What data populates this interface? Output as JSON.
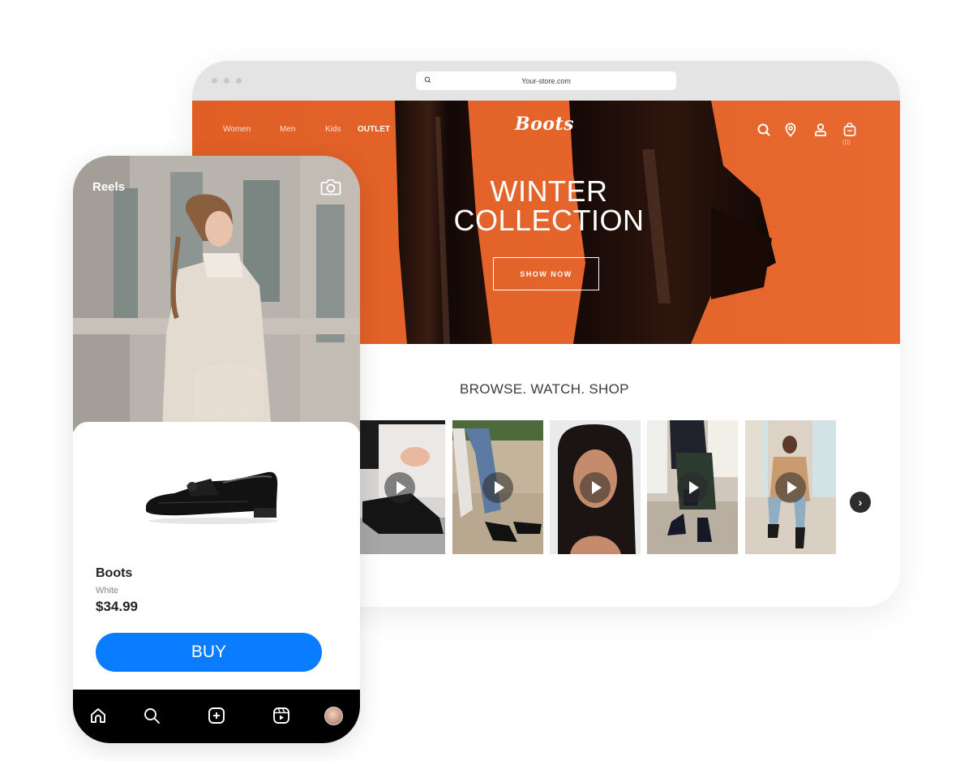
{
  "browser": {
    "url": "Your-store.com",
    "nav": {
      "items": [
        {
          "label": "Women"
        },
        {
          "label": "Men"
        },
        {
          "label": "Kids"
        },
        {
          "label": "OUTLET"
        }
      ]
    },
    "brand": "Boots",
    "icons": [
      "search-icon",
      "location-pin-icon",
      "user-icon",
      "shopping-bag-icon"
    ],
    "cart_count": "(0)",
    "hero": {
      "title_line1": "WINTER",
      "title_line2": "COLLECTION",
      "cta_label": "SHOW NOW",
      "background_color": "#e2622a"
    },
    "section_title": "BROWSE. WATCH. SHOP",
    "reels": [
      {
        "label": "reel-boots-lacing"
      },
      {
        "label": "reel-heels-jeans"
      },
      {
        "label": "reel-portrait"
      },
      {
        "label": "reel-ankle-boots-street"
      },
      {
        "label": "reel-coat-pillar"
      }
    ],
    "next_label": "›"
  },
  "phone": {
    "header_title": "Reels",
    "product": {
      "name": "Boots",
      "color": "White",
      "price": "$34.99",
      "buy_label": "BUY"
    },
    "buy_color": "#0a7cff",
    "tabbar": [
      "home-icon",
      "search-icon",
      "create-icon",
      "reels-icon",
      "profile-avatar"
    ]
  }
}
